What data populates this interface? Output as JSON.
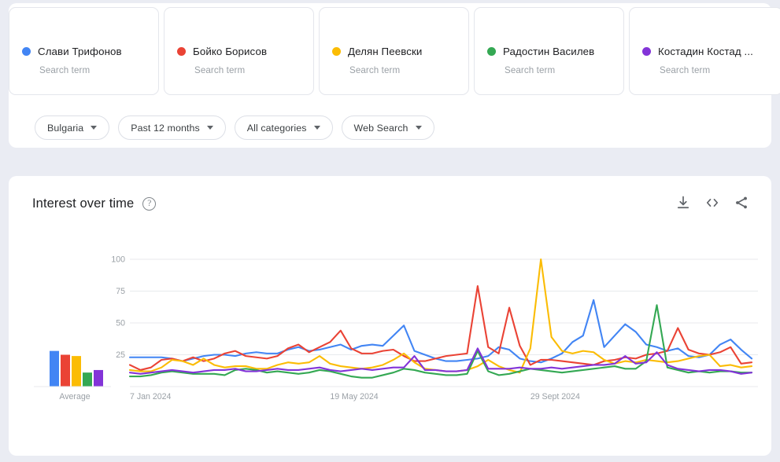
{
  "terms": [
    {
      "name": "Слави Трифонов",
      "type": "Search term",
      "color": "#4285f4",
      "truncated": false
    },
    {
      "name": "Бойко Борисов",
      "type": "Search term",
      "color": "#ea4335",
      "truncated": false
    },
    {
      "name": "Делян Пеевски",
      "type": "Search term",
      "color": "#fbbc04",
      "truncated": false
    },
    {
      "name": "Радостин Василев",
      "type": "Search term",
      "color": "#34a853",
      "truncated": false
    },
    {
      "name": "Костадин Костад ...",
      "type": "Search term",
      "color": "#8334d8",
      "truncated": true
    }
  ],
  "filters": [
    {
      "label": "Bulgaria",
      "name": "location"
    },
    {
      "label": "Past 12 months",
      "name": "time-range"
    },
    {
      "label": "All categories",
      "name": "category"
    },
    {
      "label": "Web Search",
      "name": "search-type"
    }
  ],
  "chart_panel": {
    "title": "Interest over time",
    "help_tooltip": "?",
    "actions": [
      {
        "name": "download-icon",
        "label": "Download"
      },
      {
        "name": "embed-code-icon",
        "label": "Embed"
      },
      {
        "name": "share-icon",
        "label": "Share"
      }
    ]
  },
  "chart_data": {
    "type": "line",
    "title": "Interest over time",
    "xlabel": "",
    "ylabel": "",
    "ylim": [
      0,
      100
    ],
    "yticks": [
      25,
      50,
      75,
      100
    ],
    "grid": true,
    "legend": "above-chart",
    "x_tick_labels": [
      "7 Jan 2024",
      "19 May 2024",
      "29 Sept 2024"
    ],
    "x_tick_indices": [
      0,
      19,
      38
    ],
    "n_points": 53,
    "series": [
      {
        "name": "Слави Трифонов",
        "color": "#4285f4",
        "average": 28,
        "values": [
          23,
          23,
          23,
          23,
          22,
          20,
          22,
          24,
          25,
          25,
          24,
          26,
          27,
          26,
          26,
          29,
          31,
          28,
          29,
          31,
          33,
          29,
          32,
          33,
          32,
          40,
          48,
          28,
          25,
          22,
          20,
          20,
          21,
          22,
          24,
          31,
          29,
          22,
          20,
          19,
          22,
          26,
          35,
          40,
          68,
          31,
          40,
          49,
          43,
          33,
          31,
          28,
          30,
          24,
          23,
          25,
          33,
          37,
          29,
          22
        ]
      },
      {
        "name": "Бойко Борисов",
        "color": "#ea4335",
        "average": 25,
        "values": [
          17,
          13,
          15,
          21,
          22,
          20,
          23,
          20,
          22,
          26,
          28,
          24,
          23,
          22,
          24,
          30,
          33,
          27,
          31,
          35,
          44,
          30,
          26,
          26,
          28,
          29,
          24,
          20,
          20,
          22,
          24,
          25,
          26,
          79,
          31,
          26,
          62,
          32,
          17,
          21,
          21,
          20,
          19,
          18,
          17,
          20,
          21,
          23,
          22,
          25,
          26,
          28,
          46,
          29,
          26,
          25,
          27,
          31,
          18,
          19
        ]
      },
      {
        "name": "Делян Пеевски",
        "color": "#fbbc04",
        "average": 24,
        "values": [
          13,
          12,
          12,
          15,
          21,
          20,
          17,
          22,
          17,
          15,
          16,
          16,
          14,
          14,
          17,
          19,
          18,
          19,
          24,
          18,
          16,
          15,
          14,
          15,
          17,
          21,
          26,
          19,
          14,
          13,
          12,
          12,
          13,
          16,
          21,
          16,
          13,
          11,
          30,
          100,
          39,
          28,
          26,
          28,
          27,
          21,
          18,
          20,
          19,
          21,
          20,
          19,
          20,
          22,
          24,
          25,
          16,
          17,
          15,
          16
        ]
      },
      {
        "name": "Радостин Василев",
        "color": "#34a853",
        "average": 11,
        "values": [
          8,
          8,
          9,
          11,
          12,
          11,
          10,
          10,
          10,
          9,
          13,
          14,
          13,
          11,
          12,
          11,
          10,
          11,
          13,
          12,
          10,
          8,
          7,
          7,
          9,
          11,
          14,
          13,
          11,
          10,
          9,
          9,
          10,
          28,
          12,
          9,
          10,
          12,
          14,
          13,
          12,
          11,
          12,
          13,
          14,
          15,
          16,
          14,
          14,
          20,
          64,
          15,
          13,
          11,
          12,
          11,
          12,
          12,
          11,
          11
        ]
      },
      {
        "name": "Костадин Костад ...",
        "color": "#8334d8",
        "average": 13,
        "values": [
          11,
          10,
          11,
          12,
          13,
          12,
          11,
          12,
          13,
          13,
          14,
          12,
          12,
          13,
          14,
          13,
          13,
          14,
          15,
          13,
          12,
          13,
          14,
          13,
          14,
          15,
          15,
          24,
          13,
          13,
          12,
          12,
          13,
          30,
          14,
          14,
          14,
          15,
          14,
          14,
          15,
          14,
          15,
          16,
          17,
          17,
          18,
          24,
          18,
          19,
          27,
          17,
          14,
          13,
          12,
          13,
          13,
          12,
          10,
          11
        ]
      }
    ],
    "average_bar_chart": {
      "label": "Average",
      "values": [
        28,
        25,
        24,
        11,
        13
      ],
      "colors": [
        "#4285f4",
        "#ea4335",
        "#fbbc04",
        "#34a853",
        "#8334d8"
      ]
    }
  }
}
